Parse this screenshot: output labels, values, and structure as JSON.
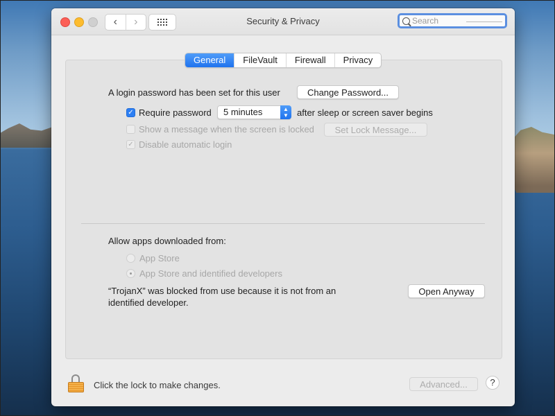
{
  "window": {
    "title": "Security & Privacy",
    "search_placeholder": "Search",
    "nav": {
      "back": "‹",
      "forward": "›"
    }
  },
  "tabs": [
    {
      "label": "General",
      "active": true
    },
    {
      "label": "FileVault",
      "active": false
    },
    {
      "label": "Firewall",
      "active": false
    },
    {
      "label": "Privacy",
      "active": false
    }
  ],
  "general": {
    "login_password_text": "A login password has been set for this user",
    "change_password_label": "Change Password...",
    "require_password": {
      "label": "Require password",
      "checked": true
    },
    "require_password_delay": "5 minutes",
    "require_password_suffix": "after sleep or screen saver begins",
    "show_message": {
      "label": "Show a message when the screen is locked",
      "checked": false,
      "enabled": false
    },
    "set_lock_message_label": "Set Lock Message...",
    "disable_auto_login": {
      "label": "Disable automatic login",
      "checked": true,
      "enabled": false
    }
  },
  "gatekeeper": {
    "heading": "Allow apps downloaded from:",
    "options": [
      {
        "label": "App Store",
        "selected": false
      },
      {
        "label": "App Store and identified developers",
        "selected": true
      }
    ],
    "blocked_message_line1": "“TrojanX” was blocked from use because it is not from an",
    "blocked_message_line2": "identified developer.",
    "open_anyway_label": "Open Anyway"
  },
  "footer": {
    "lock_text": "Click the lock to make changes.",
    "advanced_label": "Advanced...",
    "help_label": "?"
  },
  "colors": {
    "accent": "#1f73ee",
    "close": "#fc5f57",
    "minimize": "#fdbc2e",
    "lock": "#f4b04a"
  }
}
